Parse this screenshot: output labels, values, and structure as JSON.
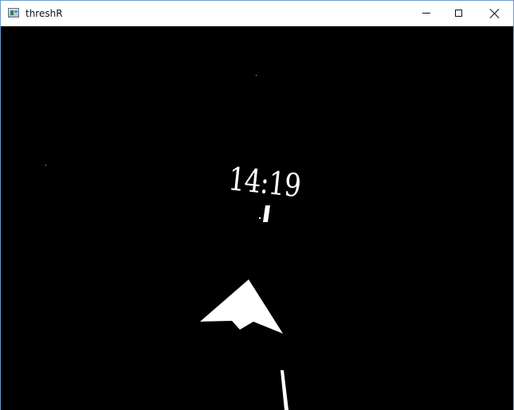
{
  "window": {
    "title": "threshR",
    "icon": "app-icon",
    "controls": {
      "minimize": "minimize-icon",
      "maximize": "maximize-icon",
      "close": "close-icon"
    }
  },
  "canvas": {
    "background": "#000000",
    "foreground": "#ffffff",
    "clock_text": "14:19"
  }
}
